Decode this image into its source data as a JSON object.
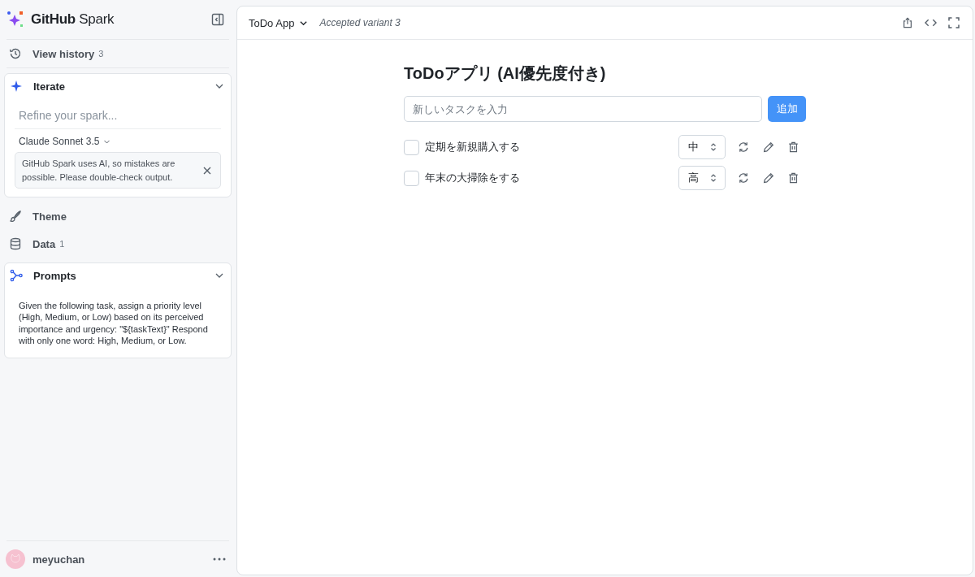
{
  "sidebar": {
    "brand": "**GitHub** Spark",
    "history": {
      "label": "View history",
      "count": "3"
    },
    "iterate": {
      "title": "Iterate",
      "expanded": true,
      "placeholder": "Refine your spark...",
      "model": "Claude Sonnet 3.5",
      "notice": "GitHub Spark uses AI, so mistakes are possible. Please double-check output."
    },
    "theme": {
      "label": "Theme"
    },
    "data": {
      "label": "Data",
      "count": "1"
    },
    "prompts": {
      "title": "Prompts",
      "expanded": true,
      "text": "Given the following task, assign a priority level (High, Medium, or Low) based on its perceived importance and urgency: \"${taskText}\" Respond with only one word: High, Medium, or Low."
    },
    "user": {
      "name": "meyuchan"
    }
  },
  "header": {
    "app_name": "ToDo App",
    "variant": "Accepted variant 3"
  },
  "todo": {
    "title": "ToDoアプリ (AI優先度付き)",
    "input": {
      "placeholder": "新しいタスクを入力"
    },
    "add_button": "追加",
    "tasks": [
      {
        "text": "定期を新規購入する",
        "checked": false,
        "priority": "中"
      },
      {
        "text": "年末の大掃除をする",
        "checked": false,
        "priority": "高"
      }
    ]
  }
}
